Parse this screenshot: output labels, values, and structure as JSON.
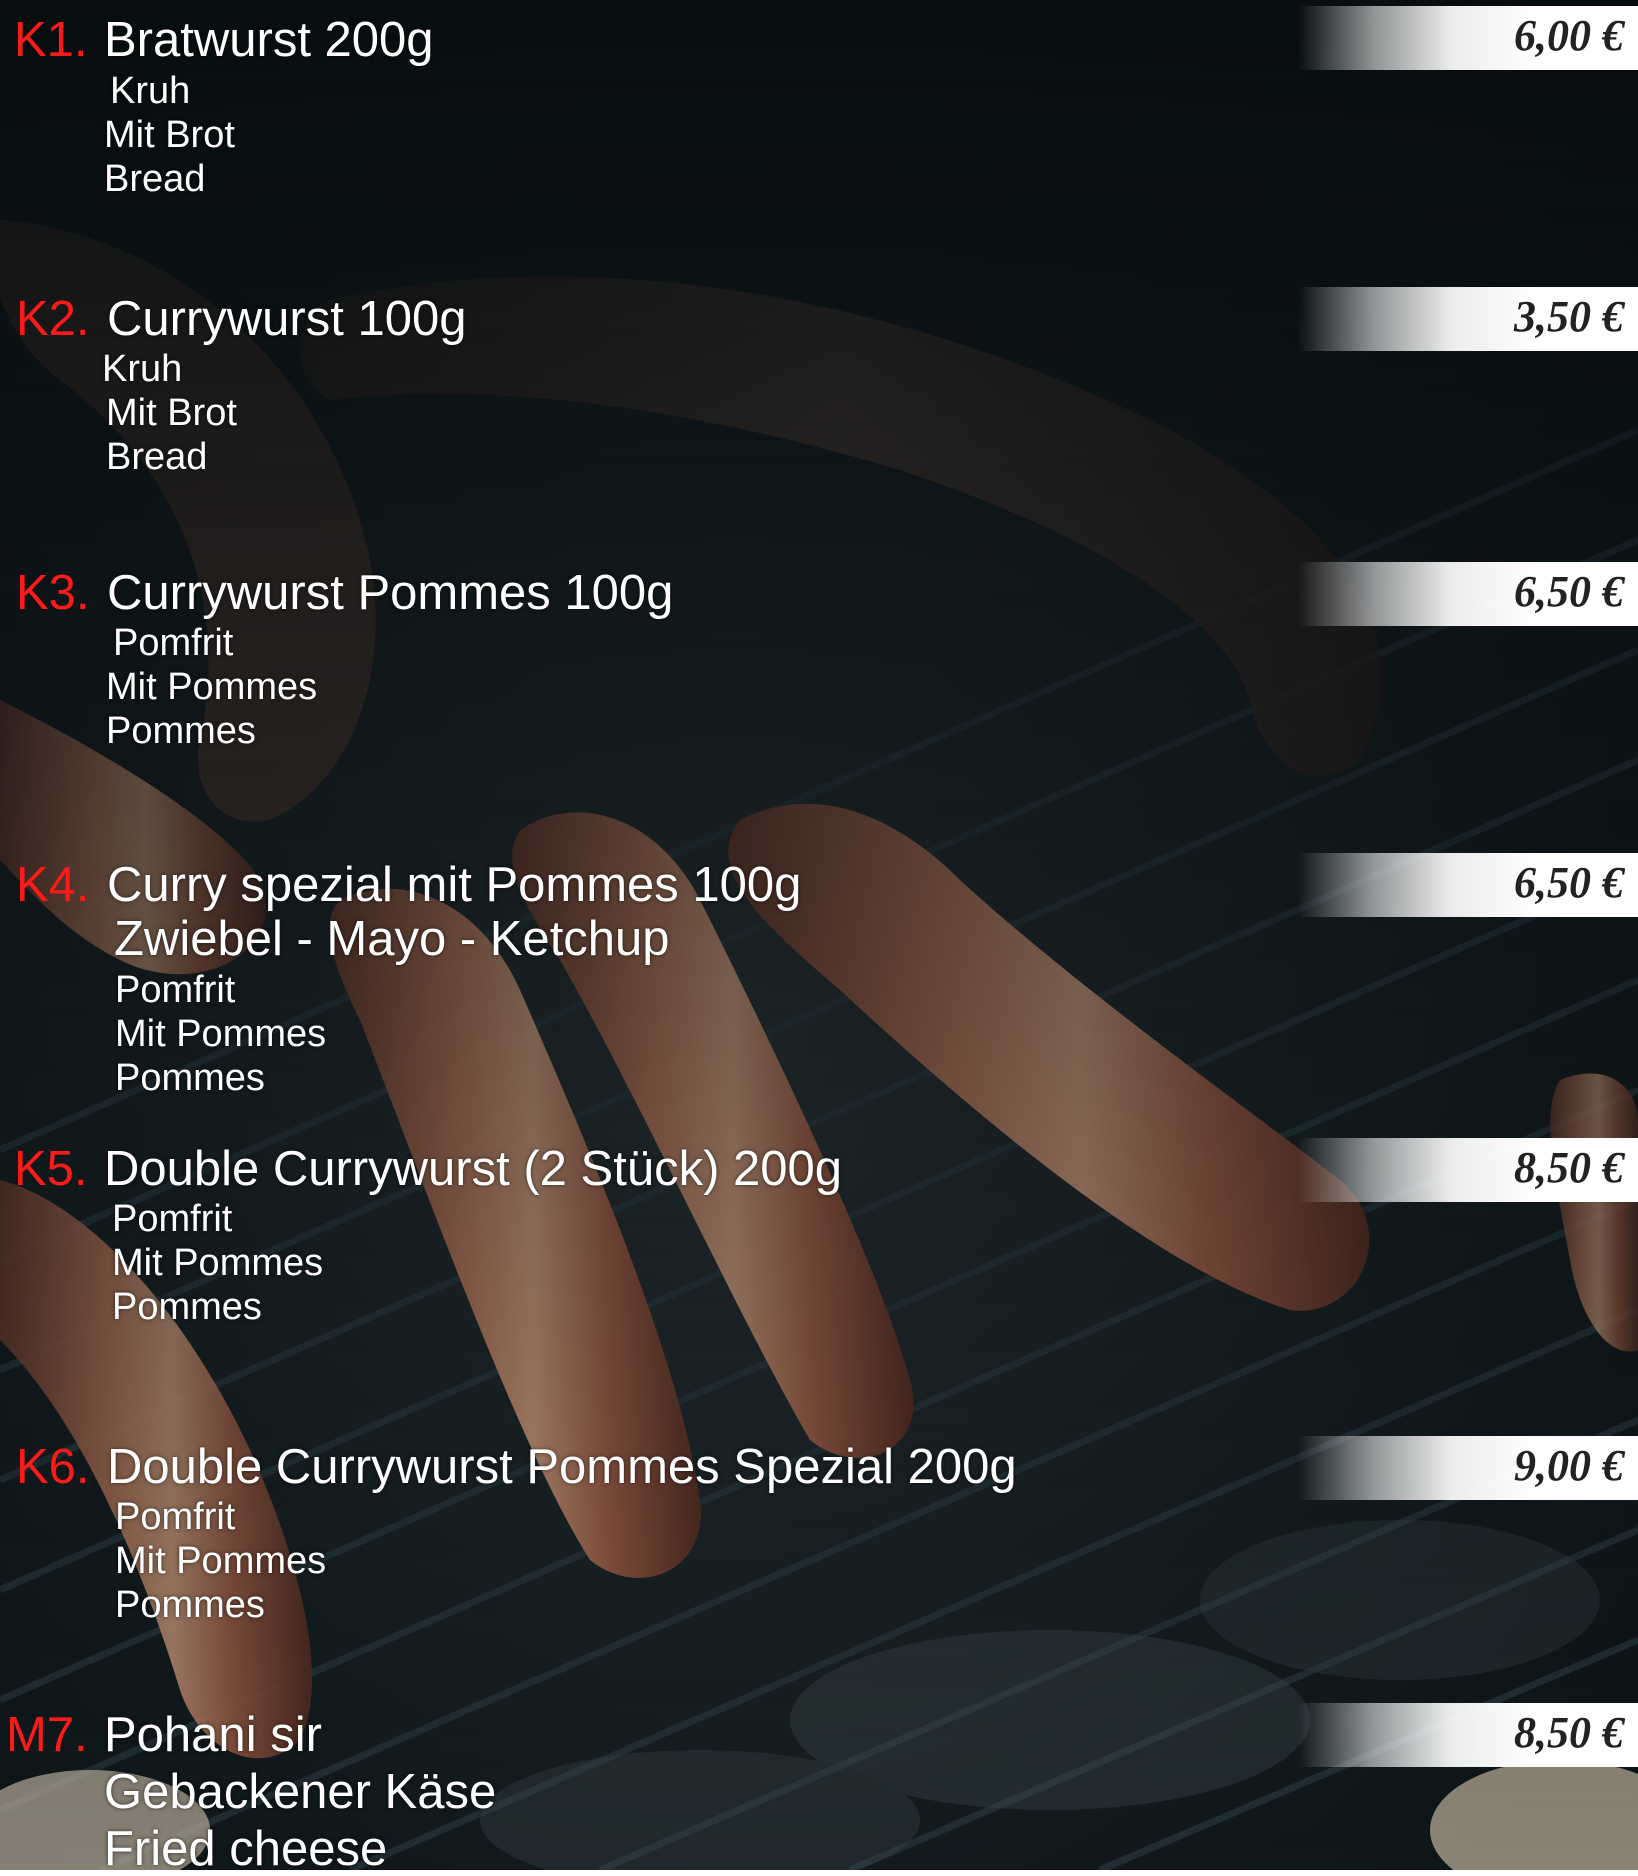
{
  "menu": {
    "items": [
      {
        "code": "K1.",
        "title": "Bratwurst 200g",
        "lines": [
          "Kruh",
          "Mit Brot",
          "Bread"
        ],
        "price": "6,00 €"
      },
      {
        "code": "K2.",
        "title": "Currywurst 100g",
        "lines": [
          "Kruh",
          "Mit Brot",
          "Bread"
        ],
        "price": "3,50 €"
      },
      {
        "code": "K3.",
        "title": "Currywurst Pommes 100g",
        "lines": [
          "Pomfrit",
          "Mit Pommes",
          "Pommes"
        ],
        "price": "6,50 €"
      },
      {
        "code": "K4.",
        "title": "Curry spezial mit Pommes 100g",
        "subtitle": "Zwiebel - Mayo - Ketchup",
        "lines": [
          "Pomfrit",
          "Mit Pommes",
          "Pommes"
        ],
        "price": "6,50 €"
      },
      {
        "code": "K5.",
        "title": "Double Currywurst (2 Stück) 200g",
        "lines": [
          "Pomfrit",
          "Mit Pommes",
          "Pommes"
        ],
        "price": "8,50 €"
      },
      {
        "code": "K6.",
        "title": "Double Currywurst Pommes Spezial 200g",
        "lines": [
          "Pomfrit",
          "Mit Pommes",
          "Pommes"
        ],
        "price": "9,00 €"
      },
      {
        "code": "M7.",
        "title": "Pohani sir",
        "lines": [
          "Gebackener Käse",
          "Fried cheese"
        ],
        "price": "8,50 €"
      }
    ]
  },
  "colors": {
    "code": "#ff1a1a",
    "text": "#ffffff",
    "price": "#222222",
    "background": "#0f1a1d"
  }
}
